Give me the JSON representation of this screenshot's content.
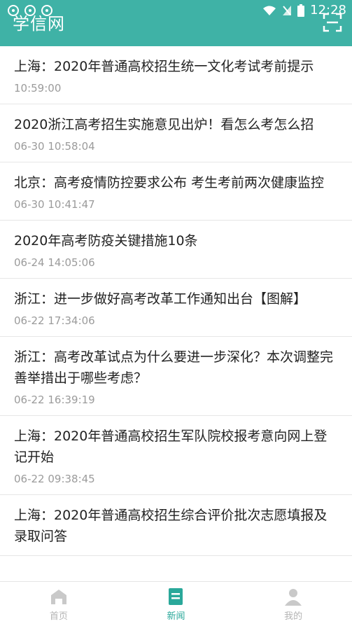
{
  "status": {
    "time": "12:28"
  },
  "app": {
    "title": "学信网"
  },
  "news": [
    {
      "title": "上海：2020年普通高校招生统一文化考试考前提示",
      "time": "10:59:00"
    },
    {
      "title": "2020浙江高考招生实施意见出炉！看怎么考怎么招",
      "time": "06-30 10:58:04"
    },
    {
      "title": "北京：高考疫情防控要求公布 考生考前两次健康监控",
      "time": "06-30 10:41:47"
    },
    {
      "title": "2020年高考防疫关键措施10条",
      "time": "06-24 14:05:06"
    },
    {
      "title": "浙江：进一步做好高考改革工作通知出台【图解】",
      "time": "06-22 17:34:06"
    },
    {
      "title": "浙江：高考改革试点为什么要进一步深化？本次调整完善举措出于哪些考虑？",
      "time": "06-22 16:39:19"
    },
    {
      "title": "上海：2020年普通高校招生军队院校报考意向网上登记开始",
      "time": "06-22 09:38:45"
    },
    {
      "title": "上海：2020年普通高校招生综合评价批次志愿填报及录取问答",
      "time": ""
    }
  ],
  "nav": {
    "home": "首页",
    "news": "新闻",
    "mine": "我的"
  },
  "colors": {
    "accent": "#3fb2a6",
    "active": "#2aa89a"
  }
}
